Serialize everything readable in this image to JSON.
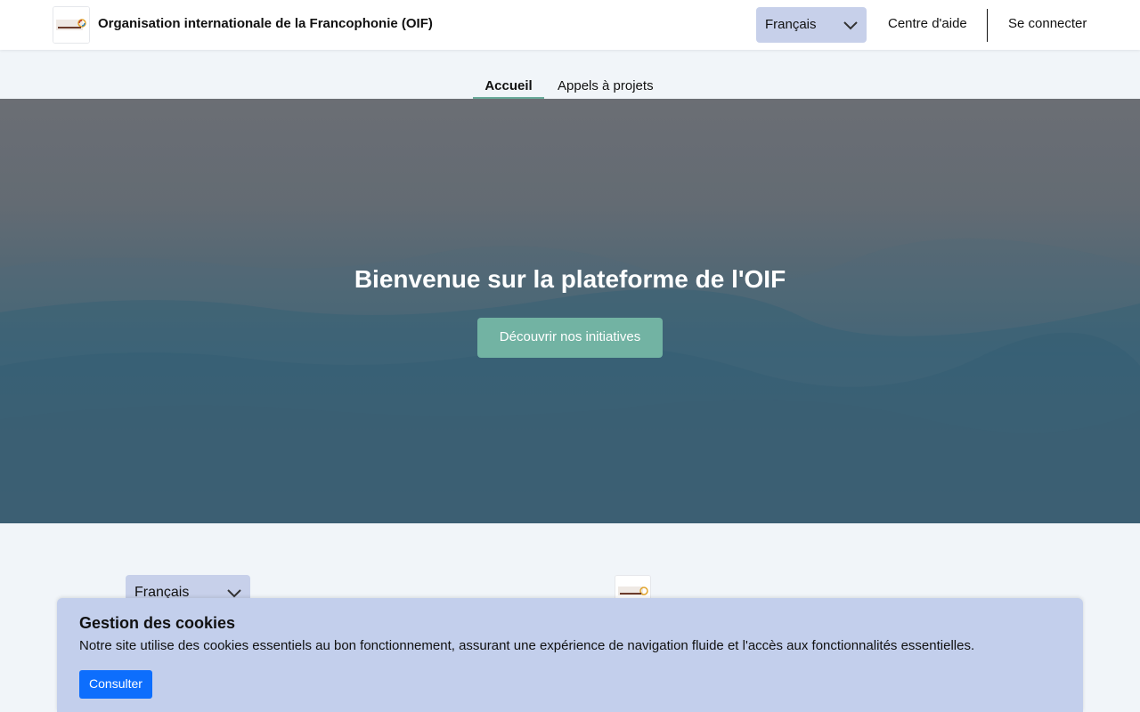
{
  "header": {
    "org_name": "Organisation internationale de la Francophonie (OIF)",
    "logo_icon": "francophonie-logo",
    "language": "Français",
    "help_link": "Centre d'aide",
    "login_link": "Se connecter"
  },
  "tabs": [
    {
      "label": "Accueil",
      "active": true
    },
    {
      "label": "Appels à projets",
      "active": false
    }
  ],
  "hero": {
    "title": "Bienvenue sur la plateforme de l'OIF",
    "cta": "Découvrir nos initiatives"
  },
  "footer": {
    "language": "Français",
    "logo_icon": "francophonie-logo"
  },
  "cookie_banner": {
    "title": "Gestion des cookies",
    "text": "Notre site utilise des cookies essentiels au bon fonctionnement, assurant une expérience de navigation fluide et l'accès aux fonctionnalités essentielles.",
    "button": "Consulter"
  },
  "colors": {
    "accent": "#72b3a3",
    "select_bg": "#c7d0ea",
    "cookie_bg": "#c3cfec",
    "primary_button": "#0d6efd"
  }
}
